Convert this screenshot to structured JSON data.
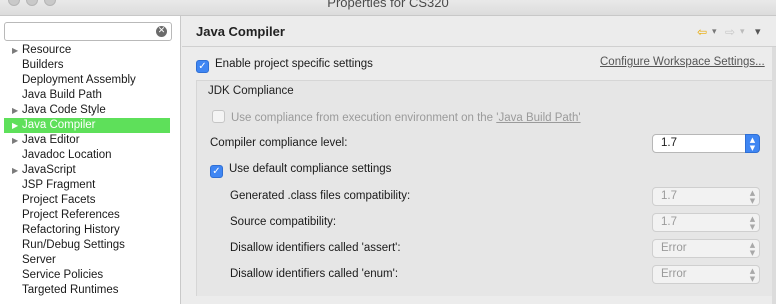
{
  "window": {
    "title": "Properties for CS320"
  },
  "search": {
    "value": "",
    "clear_icon": "✕"
  },
  "sidebar": {
    "items": [
      {
        "label": "Resource",
        "expandable": true
      },
      {
        "label": "Builders",
        "expandable": false
      },
      {
        "label": "Deployment Assembly",
        "expandable": false
      },
      {
        "label": "Java Build Path",
        "expandable": false
      },
      {
        "label": "Java Code Style",
        "expandable": true
      },
      {
        "label": "Java Compiler",
        "expandable": true,
        "selected": true
      },
      {
        "label": "Java Editor",
        "expandable": true
      },
      {
        "label": "Javadoc Location",
        "expandable": false
      },
      {
        "label": "JavaScript",
        "expandable": true
      },
      {
        "label": "JSP Fragment",
        "expandable": false
      },
      {
        "label": "Project Facets",
        "expandable": false
      },
      {
        "label": "Project References",
        "expandable": false
      },
      {
        "label": "Refactoring History",
        "expandable": false
      },
      {
        "label": "Run/Debug Settings",
        "expandable": false
      },
      {
        "label": "Server",
        "expandable": false
      },
      {
        "label": "Service Policies",
        "expandable": false
      },
      {
        "label": "Targeted Runtimes",
        "expandable": false
      }
    ],
    "selected_color": "#5ee05a"
  },
  "page": {
    "title": "Java Compiler",
    "enable_project_specific": "Enable project specific settings",
    "configure_workspace": "Configure Workspace Settings...",
    "group_title": "JDK Compliance",
    "use_compliance_env_prefix": "Use compliance from execution environment on the ",
    "use_compliance_env_link": "'Java Build Path'",
    "compliance_level_label": "Compiler compliance level:",
    "compliance_level_value": "1.7",
    "use_default_compliance": "Use default compliance settings",
    "settings": [
      {
        "label": "Generated .class files compatibility:",
        "value": "1.7"
      },
      {
        "label": "Source compatibility:",
        "value": "1.7"
      },
      {
        "label": "Disallow identifiers called 'assert':",
        "value": "Error"
      },
      {
        "label": "Disallow identifiers called 'enum':",
        "value": "Error"
      }
    ]
  },
  "icons": {
    "back": "⇦",
    "forward": "⇨",
    "dropdown": "▾",
    "checkmark": "✓",
    "stepper": "▲▼",
    "tree_arrow": "▶"
  },
  "colors": {
    "accent": "#3f86f3",
    "back_arrow": "#e8a900"
  }
}
